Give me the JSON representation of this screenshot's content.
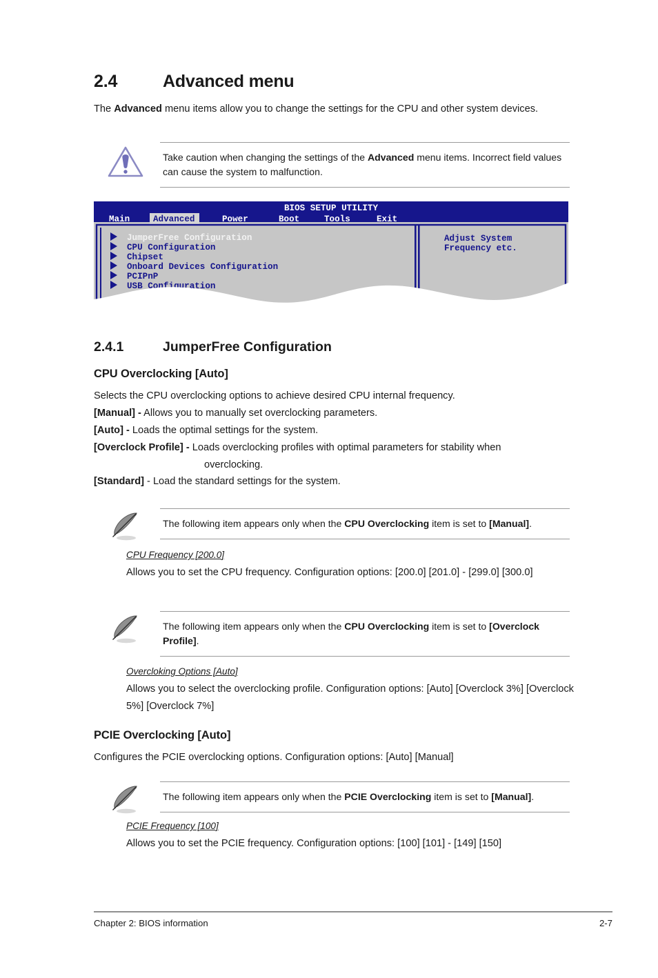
{
  "page": {
    "section_number": "2.4",
    "section_title": "Advanced menu",
    "intro_prefix": "The ",
    "intro_bold": "Advanced",
    "intro_suffix": " menu items allow you to change the settings for the CPU and other system devices."
  },
  "caution": {
    "icon": "warning-triangle-icon",
    "text_1": "Take caution when changing the settings of the ",
    "bold_1": "Advanced",
    "text_2": " menu items. Incorrect field values can cause the system to malfunction."
  },
  "bios": {
    "title": "BIOS SETUP UTILITY",
    "tabs": [
      {
        "label": "Main",
        "selected": false
      },
      {
        "label": "Advanced",
        "selected": true
      },
      {
        "label": "Power",
        "selected": false
      },
      {
        "label": "Boot",
        "selected": false
      },
      {
        "label": "Tools",
        "selected": false
      },
      {
        "label": "Exit",
        "selected": false
      }
    ],
    "menu_items": [
      {
        "label": "JumperFree Configuration",
        "highlighted": true
      },
      {
        "label": "CPU Configuration",
        "highlighted": false
      },
      {
        "label": "Chipset",
        "highlighted": false
      },
      {
        "label": "Onboard Devices Configuration",
        "highlighted": false
      },
      {
        "label": "PCIPnP",
        "highlighted": false
      },
      {
        "label": "USB Configuration",
        "highlighted": false
      }
    ],
    "help_line_1": "Adjust System",
    "help_line_2": "Frequency etc.",
    "colors": {
      "header_bg": "#16168c",
      "panel_bg": "#c6c6c6",
      "text_blue": "#16168c",
      "text_highlight": "#f2f2f2",
      "tab_selected_bg": "#d4d4d4"
    }
  },
  "subsection": {
    "number": "2.4.1",
    "title": "JumperFree Configuration"
  },
  "cpu_overclocking": {
    "heading": "CPU Overclocking [Auto]",
    "description": "Selects the CPU overclocking options to achieve desired CPU internal frequency.",
    "options": [
      {
        "label": "[Manual] -",
        "text": " Allows you to manually set overclocking parameters."
      },
      {
        "label": "[Auto] -",
        "text": " Loads the optimal settings for the system."
      },
      {
        "label": "[Overclock Profile] -",
        "text": " Loads overclocking profiles with optimal parameters for stability when",
        "continuation": "overclocking."
      },
      {
        "label": "[Standard]",
        "text": " - Load the standard settings for the system."
      }
    ]
  },
  "note_1": {
    "icon": "quill-pen-icon",
    "text_1": "The following item appears only when the ",
    "bold_1": "CPU Overclocking",
    "text_2": " item is set to ",
    "bold_2": "[Manual]",
    "text_3": "."
  },
  "cpu_frequency": {
    "title": "CPU Frequency [200.0]",
    "body": "Allows you to set the CPU frequency. Configuration options: [200.0] [201.0] - [299.0] [300.0]"
  },
  "note_2": {
    "icon": "quill-pen-icon",
    "text_1": "The following item appears only when the ",
    "bold_1": "CPU Overclocking",
    "text_2": " item is set to ",
    "bold_2": "[Overclock Profile]",
    "text_3": "."
  },
  "overclocking_options": {
    "title": "Overcloking Options [Auto]",
    "body": "Allows you to select the overclocking profile. Configuration options: [Auto] [Overclock 3%] [Overclock 5%] [Overclock 7%]"
  },
  "pcie_overclocking": {
    "heading": "PCIE Overclocking [Auto]",
    "description": "Configures the PCIE overclocking options. Configuration options: [Auto] [Manual]"
  },
  "note_3": {
    "icon": "quill-pen-icon",
    "text_1": "The following item appears only when the ",
    "bold_1": "PCIE Overclocking",
    "text_2": " item is set to ",
    "bold_2": "[Manual]",
    "text_3": "."
  },
  "pcie_frequency": {
    "title": "PCIE Frequency [100]",
    "body": "Allows you to set the PCIE frequency. Configuration options: [100] [101] - [149] [150]"
  },
  "footer": {
    "left": "Chapter 2: BIOS information",
    "right": "2-7"
  }
}
